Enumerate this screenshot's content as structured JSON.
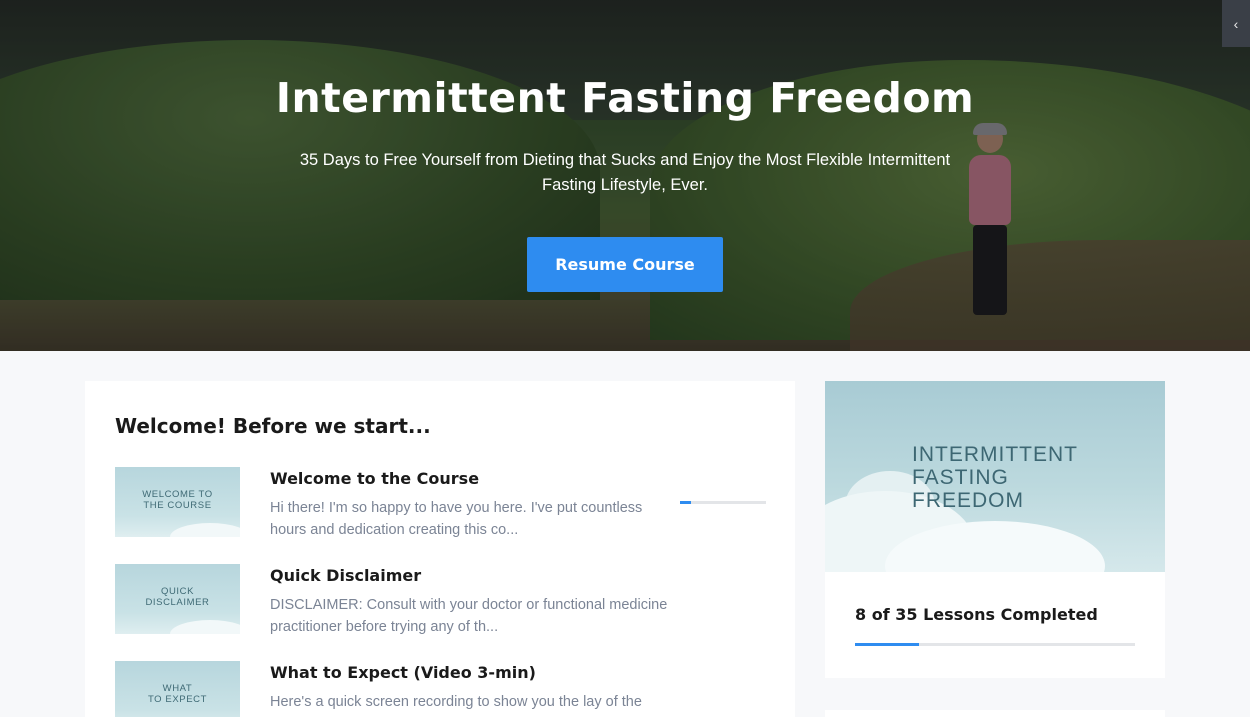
{
  "hero": {
    "title": "Intermittent Fasting Freedom",
    "subtitle": "35 Days to Free Yourself from Dieting that Sucks and Enjoy the Most Flexible Intermittent Fasting Lifestyle, Ever.",
    "resume_label": "Resume Course",
    "collapse_icon": "‹"
  },
  "section": {
    "title": "Welcome! Before we start..."
  },
  "lessons": [
    {
      "thumb_text": "Welcome to\nthe course",
      "title": "Welcome to the Course",
      "description": "Hi there! I'm so happy to have you here. I've put countless hours and dedication creating this co...",
      "progress": 0.13
    },
    {
      "thumb_text": "Quick\nDisclaimer",
      "title": "Quick Disclaimer",
      "description": "DISCLAIMER: Consult with your doctor or functional medicine practitioner before trying any of th..."
    },
    {
      "thumb_text": "What\nto expect",
      "title": "What to Expect (Video 3-min)",
      "description": "Here's a quick screen recording to show you the lay of the"
    }
  ],
  "sidebar": {
    "image_text": "Intermittent\nFasting\nFreedom",
    "completed_text": "8 of 35 Lessons Completed",
    "completed_count": 8,
    "total_count": 35
  },
  "colors": {
    "accent": "#2e8cf0",
    "text_dark": "#1a1a1a",
    "text_muted": "#7b8495"
  }
}
